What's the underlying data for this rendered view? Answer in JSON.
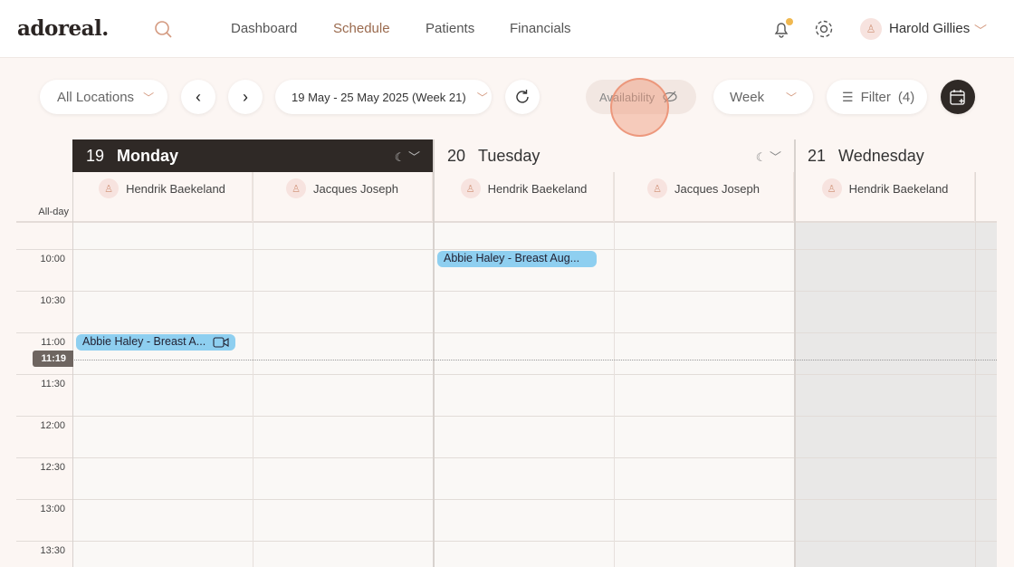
{
  "app": {
    "logo": "adoreal."
  },
  "nav": [
    {
      "label": "Dashboard"
    },
    {
      "label": "Schedule",
      "active": true
    },
    {
      "label": "Patients"
    },
    {
      "label": "Financials"
    }
  ],
  "user": {
    "name": "Harold Gillies"
  },
  "toolbar": {
    "location": "All Locations",
    "date_range": "19 May - 25 May 2025 (Week 21)",
    "availability": "Availability",
    "view": "Week",
    "filter": "Filter",
    "filter_count": "(4)"
  },
  "days": [
    {
      "num": "19",
      "name": "Monday"
    },
    {
      "num": "20",
      "name": "Tuesday"
    },
    {
      "num": "21",
      "name": "Wednesday"
    }
  ],
  "staff": [
    "Hendrik Baekeland",
    "Jacques Joseph"
  ],
  "allday": "All-day",
  "slots": [
    "10:00",
    "10:30",
    "11:00",
    "11:30",
    "12:00",
    "12:30",
    "13:00",
    "13:30"
  ],
  "now": "11:19",
  "events": [
    {
      "title": "Abbie Haley - Breast A...",
      "day": "Monday",
      "time": "11:00"
    },
    {
      "title": "Abbie Haley - Breast Aug...",
      "day": "Tuesday",
      "time": "10:00"
    }
  ],
  "colors": {
    "accent": "#9a6a4e",
    "event": "#8ecff0",
    "dark": "#2f2926"
  }
}
